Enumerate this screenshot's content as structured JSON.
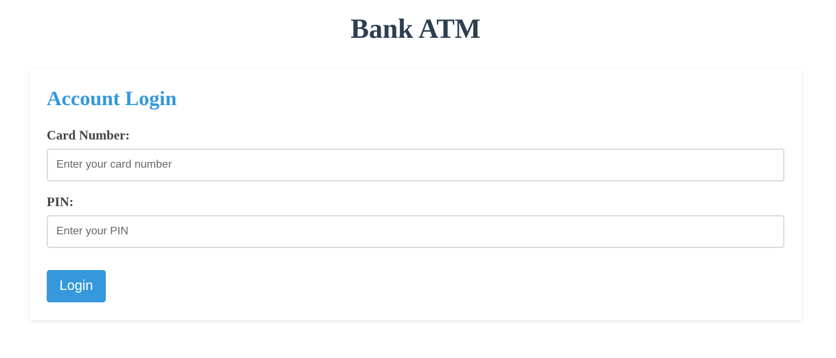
{
  "page": {
    "title": "Bank ATM"
  },
  "login_card": {
    "heading": "Account Login",
    "card_number": {
      "label": "Card Number:",
      "placeholder": "Enter your card number",
      "value": ""
    },
    "pin": {
      "label": "PIN:",
      "placeholder": "Enter your PIN",
      "value": ""
    },
    "login_button_label": "Login"
  },
  "colors": {
    "title": "#2c3e50",
    "accent": "#3498db",
    "label": "#444444",
    "input_border": "#dddddd"
  }
}
